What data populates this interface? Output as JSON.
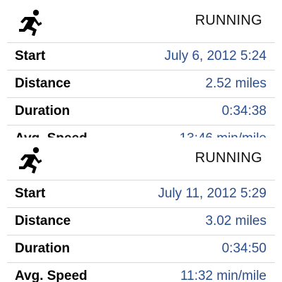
{
  "workouts": [
    {
      "type": "RUNNING",
      "icon": "runner-icon",
      "start_label": "Start",
      "start_value": "July 6, 2012 5:24",
      "distance_label": "Distance",
      "distance_value": "2.52 miles",
      "duration_label": "Duration",
      "duration_value": "0:34:38",
      "speed_label": "Avg. Speed",
      "speed_value": "13:46 min/mile"
    },
    {
      "type": "RUNNING",
      "icon": "runner-icon",
      "start_label": "Start",
      "start_value": "July 11, 2012 5:29",
      "distance_label": "Distance",
      "distance_value": "3.02 miles",
      "duration_label": "Duration",
      "duration_value": "0:34:50",
      "speed_label": "Avg. Speed",
      "speed_value": "11:32 min/mile"
    }
  ],
  "colors": {
    "value_text": "#2a4f8f",
    "label_text": "#000000",
    "divider": "#d9d9d9"
  }
}
